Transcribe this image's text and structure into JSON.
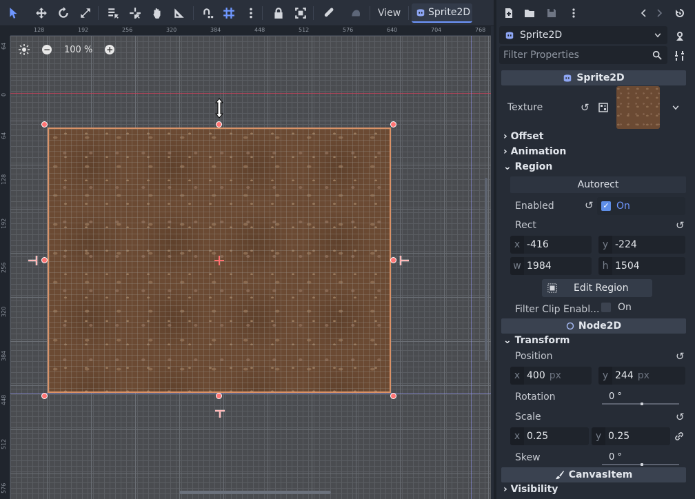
{
  "toolbar": {
    "view_label": "View",
    "tab_label": "Sprite2D"
  },
  "canvas": {
    "zoom_label": "100 %",
    "ruler_top": [
      "128",
      "192",
      "256",
      "320",
      "384",
      "448",
      "512",
      "576",
      "640",
      "704",
      "768"
    ],
    "ruler_left": [
      "64",
      "0",
      "64",
      "128",
      "192",
      "256",
      "320",
      "384",
      "448",
      "512",
      "576"
    ]
  },
  "inspector": {
    "node_name": "Sprite2D",
    "filter_placeholder": "Filter Properties",
    "sprite_section": "Sprite2D",
    "texture_label": "Texture",
    "groups": {
      "offset": "Offset",
      "animation": "Animation",
      "region": "Region"
    },
    "region": {
      "autorect_label": "Autorect",
      "enabled_label": "Enabled",
      "enabled_value": "On",
      "rect_label": "Rect",
      "x": "-416",
      "y": "-224",
      "w": "1984",
      "h": "1504",
      "edit_region_label": "Edit Region",
      "filter_clip_label": "Filter Clip Enabl...",
      "filter_clip_value": "On"
    },
    "node2d_section": "Node2D",
    "transform": {
      "title": "Transform",
      "position_label": "Position",
      "pos_x": "400",
      "pos_y": "244",
      "unit": "px",
      "rotation_label": "Rotation",
      "rotation_value": "0 °",
      "scale_label": "Scale",
      "scale_x": "0.25",
      "scale_y": "0.25",
      "skew_label": "Skew",
      "skew_value": "0 °"
    },
    "canvasitem_section": "CanvasItem",
    "visibility_label": "Visibility",
    "axis_letters": {
      "x": "x",
      "y": "y",
      "w": "w",
      "h": "h"
    }
  },
  "colors": {
    "accent": "#6f97ff",
    "selection": "#d99267",
    "handle": "#ff7474"
  }
}
